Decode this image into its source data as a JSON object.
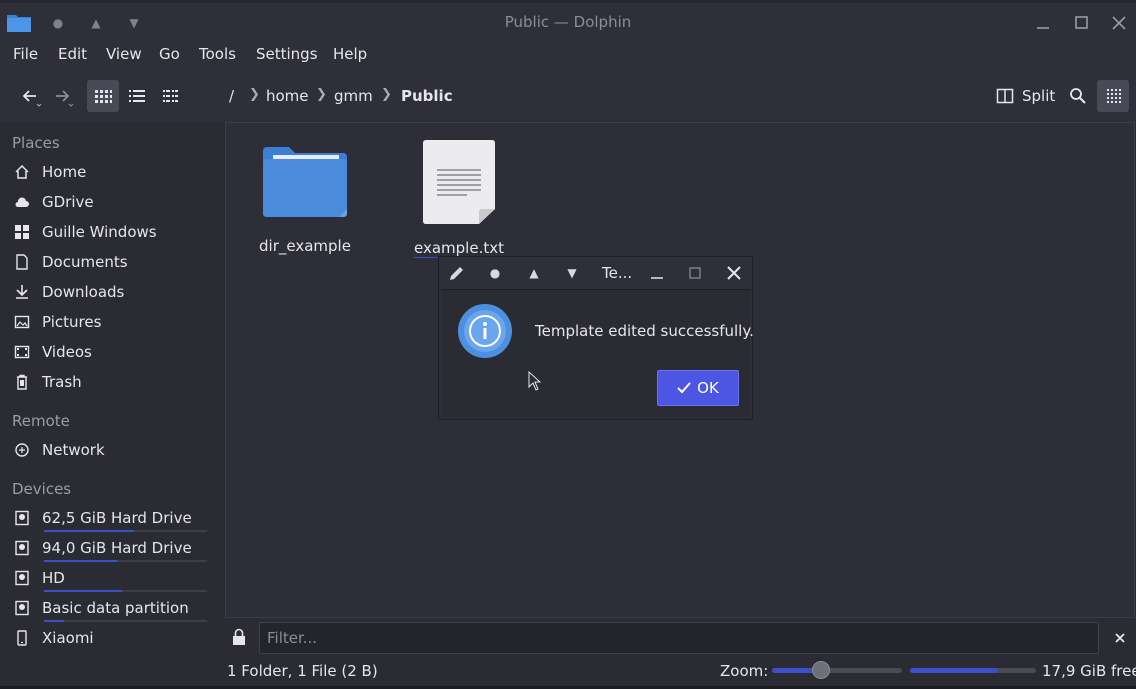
{
  "window": {
    "title": "Public — Dolphin"
  },
  "menubar": [
    "File",
    "Edit",
    "View",
    "Go",
    "Tools",
    "Settings",
    "Help"
  ],
  "breadcrumb": {
    "root": "/",
    "items": [
      "home",
      "gmm",
      "Public"
    ]
  },
  "toolbar": {
    "split_label": "Split"
  },
  "sidebar": {
    "places_heading": "Places",
    "places": [
      {
        "label": "Home",
        "icon": "home-icon"
      },
      {
        "label": "GDrive",
        "icon": "cloud-icon"
      },
      {
        "label": "Guille Windows",
        "icon": "windows-icon"
      },
      {
        "label": "Documents",
        "icon": "document-icon"
      },
      {
        "label": "Downloads",
        "icon": "download-icon"
      },
      {
        "label": "Pictures",
        "icon": "picture-icon"
      },
      {
        "label": "Videos",
        "icon": "video-icon"
      },
      {
        "label": "Trash",
        "icon": "trash-icon"
      }
    ],
    "remote_heading": "Remote",
    "remote": [
      {
        "label": "Network",
        "icon": "network-icon"
      }
    ],
    "devices_heading": "Devices",
    "devices": [
      {
        "label": "62,5 GiB Hard Drive",
        "icon": "harddrive-icon",
        "usage": 0.55
      },
      {
        "label": "94,0 GiB Hard Drive",
        "icon": "harddrive-icon",
        "usage": 0.45
      },
      {
        "label": "HD",
        "icon": "harddrive-icon",
        "usage": 0.48
      },
      {
        "label": "Basic data partition",
        "icon": "harddrive-icon",
        "usage": 0.12
      },
      {
        "label": "Xiaomi",
        "icon": "phone-icon"
      }
    ]
  },
  "files": [
    {
      "name": "dir_example",
      "type": "folder"
    },
    {
      "name": "example.txt",
      "type": "text"
    }
  ],
  "dialog": {
    "title": "Te...",
    "message": "Template edited successfully.",
    "ok_label": "OK"
  },
  "filter": {
    "placeholder": "Filter..."
  },
  "status": {
    "summary": "1 Folder, 1 File (2 B)",
    "zoom_label": "Zoom:",
    "zoom_level": 0.38,
    "disk_used": 0.7,
    "free_text": "17,9 GiB free"
  },
  "colors": {
    "accent": "#3d4fc6",
    "ok_button": "#4c56e3",
    "folder": "#4b8bdc"
  }
}
